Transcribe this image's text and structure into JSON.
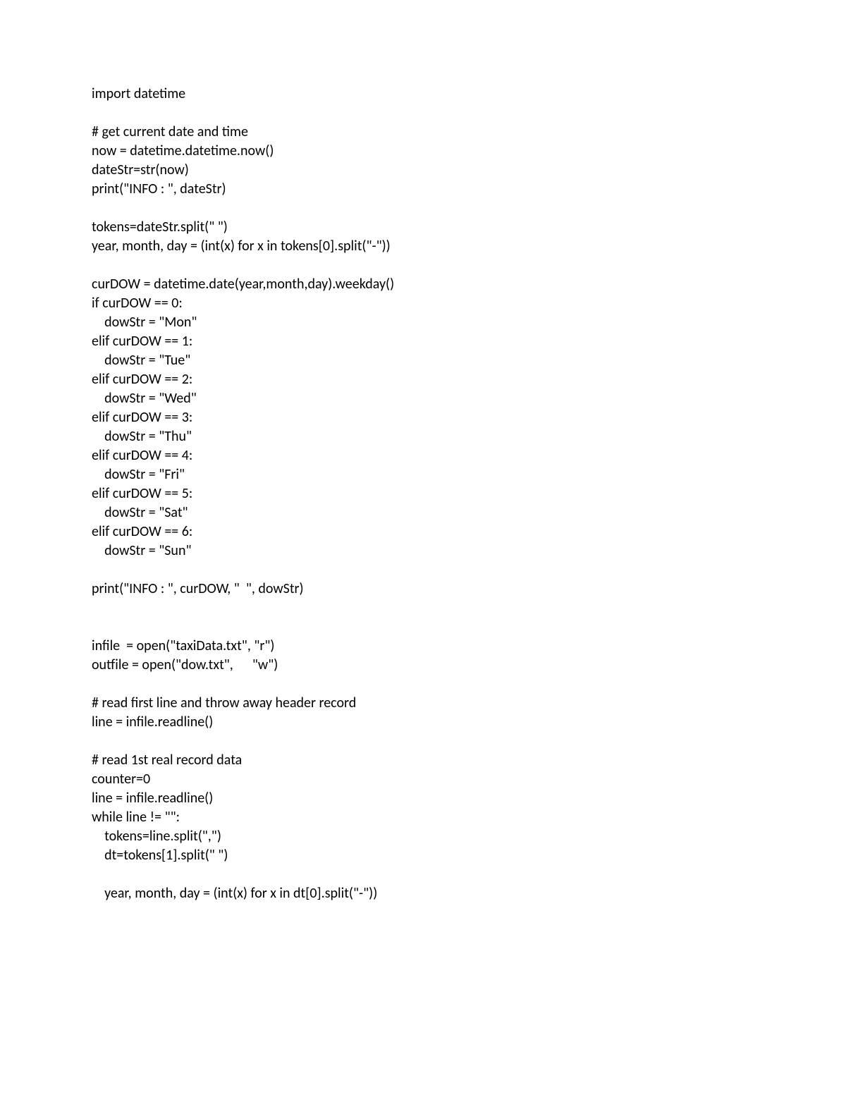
{
  "code_lines": [
    "import datetime",
    "",
    "# get current date and time",
    "now = datetime.datetime.now()",
    "dateStr=str(now)",
    "print(\"INFO : \", dateStr)",
    "",
    "tokens=dateStr.split(\" \")",
    "year, month, day = (int(x) for x in tokens[0].split(\"-\"))",
    "",
    "curDOW = datetime.date(year,month,day).weekday()",
    "if curDOW == 0:",
    "    dowStr = \"Mon\"",
    "elif curDOW == 1:",
    "    dowStr = \"Tue\"",
    "elif curDOW == 2:",
    "    dowStr = \"Wed\"",
    "elif curDOW == 3:",
    "    dowStr = \"Thu\"",
    "elif curDOW == 4:",
    "    dowStr = \"Fri\"",
    "elif curDOW == 5:",
    "    dowStr = \"Sat\"",
    "elif curDOW == 6:",
    "    dowStr = \"Sun\"",
    "",
    "print(\"INFO : \", curDOW, \"  \", dowStr)",
    "",
    "",
    "infile  = open(\"taxiData.txt\", \"r\")",
    "outfile = open(\"dow.txt\",      \"w\")",
    "",
    "# read first line and throw away header record",
    "line = infile.readline()",
    "",
    "# read 1st real record data",
    "counter=0",
    "line = infile.readline()",
    "while line != \"\":",
    "    tokens=line.split(\",\")",
    "    dt=tokens[1].split(\" \")",
    "",
    "    year, month, day = (int(x) for x in dt[0].split(\"-\"))"
  ]
}
